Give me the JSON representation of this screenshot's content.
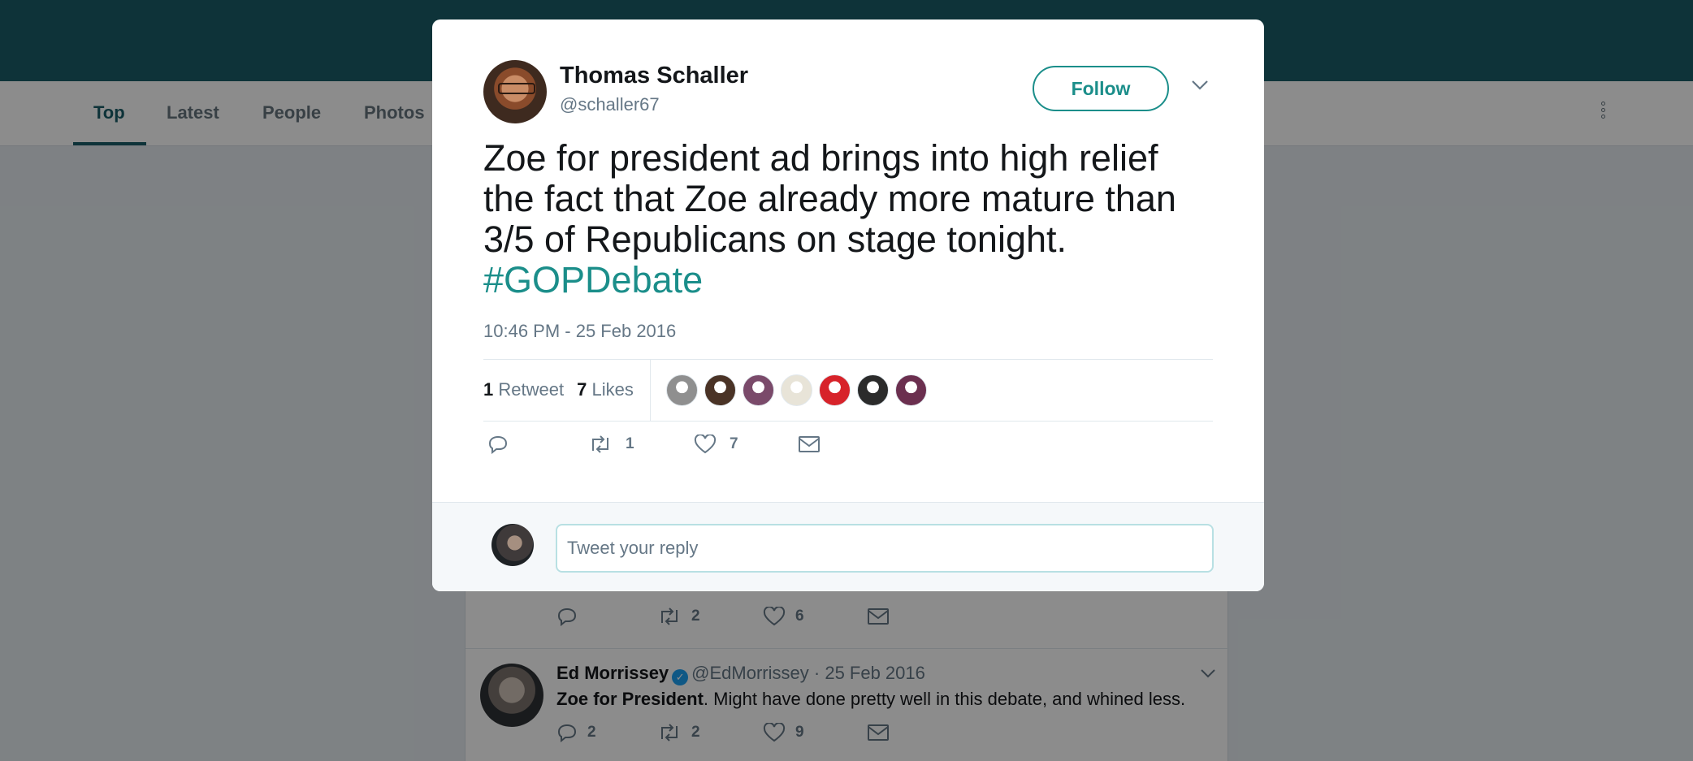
{
  "nav": {
    "tabs": [
      {
        "label": "Top",
        "active": true
      },
      {
        "label": "Latest"
      },
      {
        "label": "People"
      },
      {
        "label": "Photos"
      }
    ],
    "more_icon": "vertical-dots-icon"
  },
  "timeline": {
    "tweet1_actions": {
      "retweets": "2",
      "likes": "6"
    },
    "tweet2": {
      "name": "Ed Morrissey",
      "handle": "@EdMorrissey",
      "date": "· 25 Feb 2016",
      "text_bold": "Zoe for President",
      "text_rest": ". Might have done pretty well in this debate, and whined less.",
      "replies": "2",
      "retweets": "2",
      "likes": "9"
    }
  },
  "modal": {
    "author_name": "Thomas Schaller",
    "author_handle": "@schaller67",
    "follow_label": "Follow",
    "tweet_text": "Zoe for president ad brings into high relief the fact that Zoe already more mature than 3/5 of Republicans on stage tonight.",
    "hashtag": "#GOPDebate",
    "timestamp": "10:46 PM - 25 Feb 2016",
    "retweet_count": "1",
    "retweet_label": "Retweet",
    "likes_count": "7",
    "likes_label": "Likes",
    "actions": {
      "retweets": "1",
      "likes": "7"
    },
    "reply_placeholder": "Tweet your reply",
    "liker_colors": [
      "#8f8f8f",
      "#4a3326",
      "#7a4a6a",
      "#e8e4d8",
      "#d7232a",
      "#2b2b2b",
      "#6b2f4f"
    ]
  },
  "colors": {
    "brand": "#1b5e69",
    "accent": "#1b8e8a",
    "link": "#1b8e8a"
  }
}
